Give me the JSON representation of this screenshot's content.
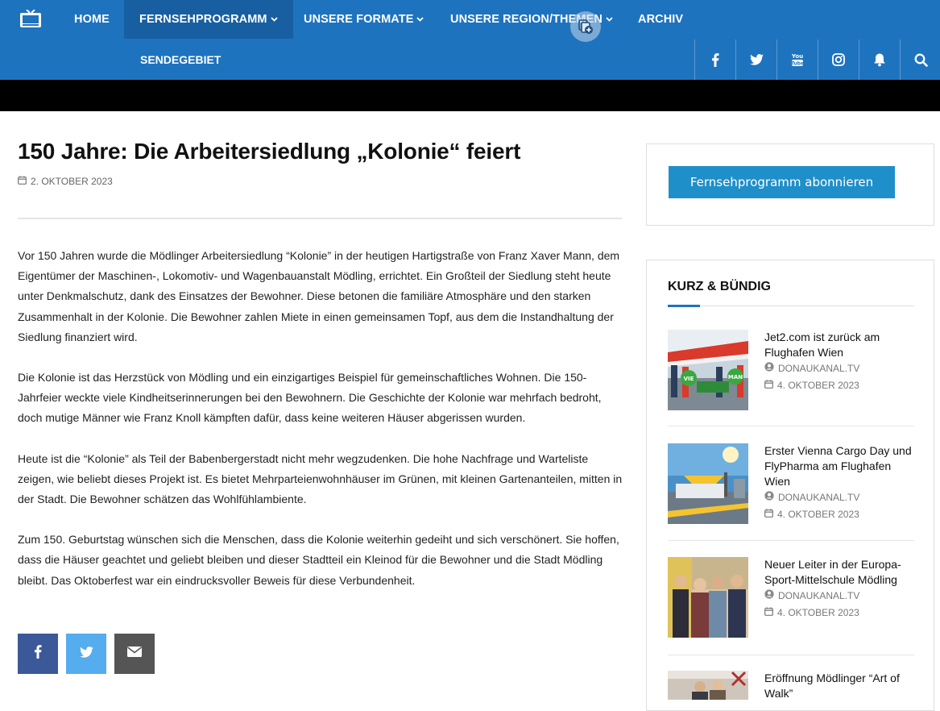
{
  "colors": {
    "header": "#1e73be",
    "nav_active": "#175fa0",
    "cta": "#1f8fc9",
    "facebook": "#3b5998",
    "twitter": "#55acee",
    "email": "#555555"
  },
  "nav": {
    "items": [
      {
        "label": "HOME",
        "dropdown": false
      },
      {
        "label": "FERNSEHPROGRAMM",
        "dropdown": true
      },
      {
        "label": "UNSERE FORMATE",
        "dropdown": true
      },
      {
        "label": "UNSERE REGION/THEMEN",
        "dropdown": true
      },
      {
        "label": "ARCHIV",
        "dropdown": false
      }
    ],
    "submenu": [
      "SENDEGEBIET"
    ],
    "social_icons": [
      "facebook-icon",
      "twitter-icon",
      "youtube-icon",
      "instagram-icon",
      "bell-icon",
      "search-icon"
    ]
  },
  "article": {
    "title": "150 Jahre: Die Arbeitersiedlung „Kolonie“ feiert",
    "date": "2. OKTOBER 2023",
    "paragraphs": [
      "Vor 150 Jahren wurde die Mödlinger Arbeitersiedlung “Kolonie” in der heutigen Hartigstraße von Franz Xaver Mann, dem Eigentümer der Maschinen-, Lokomotiv- und Wagenbauanstalt Mödling, errichtet. Ein Großteil der Siedlung steht heute unter Denkmalschutz, dank des Einsatzes der Bewohner. Diese betonen die familiäre Atmosphäre und den starken Zusammenhalt in der Kolonie. Die Bewohner zahlen Miete in einen gemeinsamen Topf, aus dem die Instandhaltung der Siedlung finanziert wird.",
      "Die Kolonie ist das Herzstück von Mödling und ein einzigartiges Beispiel für gemeinschaftliches Wohnen. Die 150-Jahrfeier weckte viele Kindheitserinnerungen bei den Bewohnern. Die Geschichte der Kolonie war mehrfach bedroht, doch mutige Männer wie Franz Knoll kämpften dafür, dass keine weiteren Häuser abgerissen wurden.",
      "Heute ist die “Kolonie” als Teil der Babenbergerstadt nicht mehr wegzudenken. Die hohe Nachfrage und Warteliste zeigen, wie beliebt dieses Projekt ist. Es bietet Mehrparteienwohnhäuser im Grünen, mit kleinen Gartenanteilen, mitten in der Stadt. Die Bewohner schätzen das Wohlfühlambiente.",
      "Zum 150. Geburtstag wünschen sich die Menschen, dass die Kolonie weiterhin gedeiht und sich verschönert. Sie hoffen, dass die Häuser geachtet und geliebt bleiben und dieser Stadtteil ein Kleinod für die Bewohner und die Stadt Mödling bleibt. Das Oktoberfest war ein eindrucksvoller Beweis für diese Verbundenheit."
    ],
    "share_icons": [
      "facebook-icon",
      "twitter-icon",
      "envelope-icon"
    ]
  },
  "sidebar": {
    "cta_label": "Fernsehprogramm abonnieren",
    "widget_title": "KURZ & BÜNDIG",
    "news": [
      {
        "title": "Jet2.com ist zurück am Flughafen Wien",
        "author": "DONAUKANAL.TV",
        "date": "4. OKTOBER 2023",
        "thumb_text": [
          "VIE",
          "MAN"
        ]
      },
      {
        "title": "Erster Vienna Cargo Day und FlyPharma am Flughafen Wien",
        "author": "DONAUKANAL.TV",
        "date": "4. OKTOBER 2023"
      },
      {
        "title": "Neuer Leiter in der Europa-Sport-Mittelschule Mödling",
        "author": "DONAUKANAL.TV",
        "date": "4. OKTOBER 2023"
      },
      {
        "title": "Eröffnung Mödlinger “Art of Walk”",
        "author": "",
        "date": ""
      }
    ]
  }
}
